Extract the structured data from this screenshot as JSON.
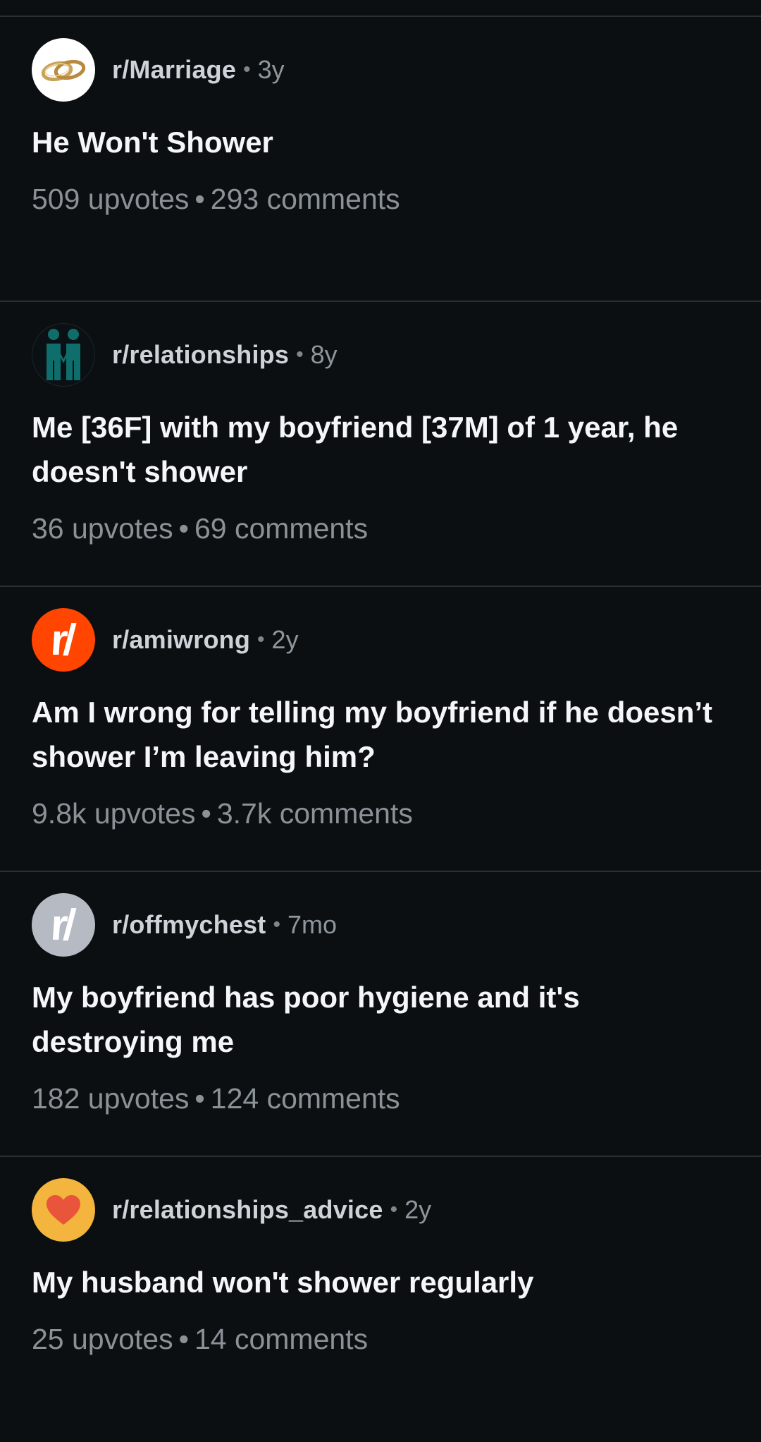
{
  "posts": [
    {
      "subreddit": "r/Marriage",
      "age": "3y",
      "title": "He Won't Shower",
      "upvotes": "509 upvotes",
      "comments": "293 comments",
      "icon": "wedding-rings-icon"
    },
    {
      "subreddit": "r/relationships",
      "age": "8y",
      "title": "Me [36F] with my boyfriend [37M] of 1 year, he doesn't shower",
      "upvotes": "36 upvotes",
      "comments": "69 comments",
      "icon": "couple-figures-icon"
    },
    {
      "subreddit": "r/amiwrong",
      "age": "2y",
      "title": "Am I wrong for telling my boyfriend if he doesn’t shower I’m leaving him?",
      "upvotes": "9.8k upvotes",
      "comments": "3.7k comments",
      "icon": "reddit-r-slash-icon",
      "avatar_text": "r/"
    },
    {
      "subreddit": "r/offmychest",
      "age": "7mo",
      "title": "My boyfriend has poor hygiene and it's destroying me",
      "upvotes": "182 upvotes",
      "comments": "124 comments",
      "icon": "reddit-r-slash-icon",
      "avatar_text": "r/"
    },
    {
      "subreddit": "r/relationships_advice",
      "age": "2y",
      "title": "My husband won't shower regularly",
      "upvotes": "25 upvotes",
      "comments": "14 comments",
      "icon": "heart-icon"
    }
  ],
  "separator": "•",
  "colors": {
    "background": "#0c0f12",
    "divider": "#2a2f33",
    "title_text": "#f4f6f7",
    "meta_text": "#8a9197",
    "amiwrong_avatar": "#ff4500",
    "offmychest_avatar": "#b6bac3",
    "advice_avatar": "#f3b53e",
    "relationships_icon": "#0f6e6b"
  }
}
